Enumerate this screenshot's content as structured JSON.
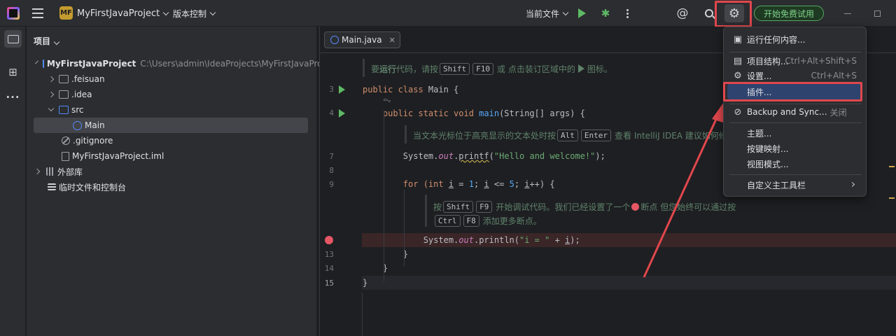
{
  "titlebar": {
    "project_badge": "MF",
    "project_name": "MyFirstJavaProject",
    "vcs_label": "版本控制",
    "run_config": "当前文件",
    "trial_label": "开始免费试用",
    "icons": [
      "intellij-logo-icon",
      "hamburger-menu-icon",
      "run-icon",
      "debug-icon",
      "more-vertical-icon",
      "ai-assistant-icon",
      "search-icon",
      "gear-icon",
      "minimize-icon",
      "maximize-icon"
    ]
  },
  "project_panel": {
    "title": "项目",
    "tree": [
      {
        "label": "MyFirstJavaProject",
        "path": "C:\\Users\\admin\\IdeaProjects\\MyFirstJavaProject"
      },
      {
        "label": ".feisuan"
      },
      {
        "label": ".idea"
      },
      {
        "label": "src"
      },
      {
        "label": "Main"
      },
      {
        "label": ".gitignore"
      },
      {
        "label": "MyFirstJavaProject.iml"
      },
      {
        "label": "外部库"
      },
      {
        "label": "临时文件和控制台"
      }
    ]
  },
  "editor": {
    "tab_label": "Main.java",
    "line_numbers": [
      "3",
      "4",
      "7",
      "8",
      "9",
      "13",
      "14",
      "15"
    ],
    "doc1": {
      "pre": "要",
      "bold": "运行",
      "mid": "代码，请按",
      "k1": "Shift",
      "k2": "F10",
      "post": "或 点击装订区域中的",
      "post2": "图标。"
    },
    "doc2": {
      "pre": "当文本光标位于高亮显示的文本处时按",
      "k1": "Alt",
      "k2": "Enter",
      "post": "查看 IntelliJ IDEA 建议如何修"
    },
    "doc3": {
      "pre": "按",
      "k1": "Shift",
      "k2": "F9",
      "mid": "开始调试代码。我们已经设置了一个",
      "post": "断点 但您始终可以通过按"
    },
    "doc4": {
      "k1": "Ctrl",
      "k2": "F8",
      "post": "添加更多断点。"
    },
    "code": {
      "l3a": "public class ",
      "l3b": "Main {",
      "l4a": "    public static void ",
      "l4b": "main",
      "l4c": "(String[] args) {",
      "l7a": "        System.",
      "l7b": "out",
      "l7c": ".",
      "l7d": "printf",
      "l7e": "(",
      "l7f": "\"Hello and welcome!\"",
      "l7g": ");",
      "l9a": "        for ",
      "l9b": "(int ",
      "l9c": "i",
      "l9d": " = ",
      "l9e": "1",
      "l9f": "; ",
      "l9g": "i",
      "l9h": " <= ",
      "l9i": "5",
      "l9j": "; ",
      "l9k": "i",
      "l9l": "++) {",
      "l12a": "            System.",
      "l12b": "out",
      "l12c": ".println(",
      "l12d": "\"i = \"",
      "l12e": " + ",
      "l12f": "i",
      "l12g": ");",
      "l13": "        }",
      "l14": "    }",
      "l15": "}"
    }
  },
  "menu": {
    "items": [
      {
        "label": "运行任何内容...",
        "shortcut": ""
      },
      {
        "label": "项目结构...",
        "shortcut": "Ctrl+Alt+Shift+S"
      },
      {
        "label": "设置...",
        "shortcut": "Ctrl+Alt+S"
      },
      {
        "label": "插件...",
        "shortcut": ""
      },
      {
        "label": "Backup and Sync...",
        "shortcut": "",
        "suffix": "关闭"
      },
      {
        "label": "主题...",
        "shortcut": ""
      },
      {
        "label": "按键映射...",
        "shortcut": ""
      },
      {
        "label": "视图模式...",
        "shortcut": ""
      },
      {
        "label": "自定义主工具栏",
        "shortcut": ""
      }
    ]
  },
  "colors": {
    "highlight": "#e0474d",
    "accent": "#2e436e",
    "run_green": "#5fb865",
    "breakpoint": "#e55765"
  }
}
